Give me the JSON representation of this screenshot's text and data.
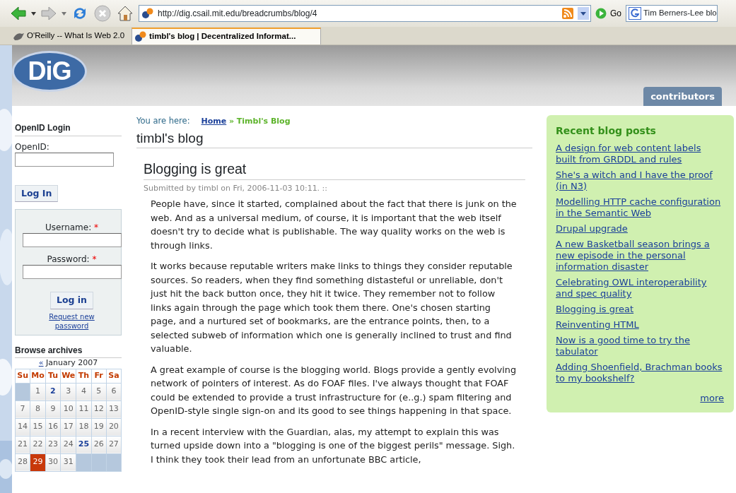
{
  "browser": {
    "url": "http://dig.csail.mit.edu/breadcrumbs/blog/4",
    "go_label": "Go",
    "search_value": "Tim Berners-Lee blo",
    "tabs": [
      {
        "label": "O'Reilly -- What Is Web 2.0",
        "selected": false
      },
      {
        "label": "timbl's blog | Decentralized Informat...",
        "selected": true
      }
    ]
  },
  "header": {
    "logo_text": "DiG",
    "nav_tab": "contributors"
  },
  "sidebar": {
    "openid": {
      "title": "OpenID Login",
      "label": "OpenID:",
      "button": "Log In"
    },
    "login": {
      "fields": [
        {
          "label": "Username:",
          "required_mark": "*"
        },
        {
          "label": "Password:",
          "required_mark": "*"
        }
      ],
      "button": "Log in",
      "link": "Request new password"
    },
    "archives": {
      "title": "Browse archives",
      "prev": "«",
      "month": "January 2007",
      "weekdays": [
        "Su",
        "Mo",
        "Tu",
        "We",
        "Th",
        "Fr",
        "Sa"
      ],
      "weeks": [
        [
          {
            "kind": "empty"
          },
          {
            "text": "1",
            "kind": "plain"
          },
          {
            "text": "2",
            "kind": "link"
          },
          {
            "text": "3",
            "kind": "plain"
          },
          {
            "text": "4",
            "kind": "plain"
          },
          {
            "text": "5",
            "kind": "plain"
          },
          {
            "text": "6",
            "kind": "plain"
          }
        ],
        [
          {
            "text": "7",
            "kind": "plain"
          },
          {
            "text": "8",
            "kind": "plain"
          },
          {
            "text": "9",
            "kind": "plain"
          },
          {
            "text": "10",
            "kind": "plain"
          },
          {
            "text": "11",
            "kind": "plain"
          },
          {
            "text": "12",
            "kind": "plain"
          },
          {
            "text": "13",
            "kind": "plain"
          }
        ],
        [
          {
            "text": "14",
            "kind": "plain"
          },
          {
            "text": "15",
            "kind": "plain"
          },
          {
            "text": "16",
            "kind": "plain"
          },
          {
            "text": "17",
            "kind": "plain"
          },
          {
            "text": "18",
            "kind": "plain"
          },
          {
            "text": "19",
            "kind": "plain"
          },
          {
            "text": "20",
            "kind": "plain"
          }
        ],
        [
          {
            "text": "21",
            "kind": "plain"
          },
          {
            "text": "22",
            "kind": "plain"
          },
          {
            "text": "23",
            "kind": "plain"
          },
          {
            "text": "24",
            "kind": "plain"
          },
          {
            "text": "25",
            "kind": "link"
          },
          {
            "text": "26",
            "kind": "plain"
          },
          {
            "text": "27",
            "kind": "plain"
          }
        ],
        [
          {
            "text": "28",
            "kind": "plain"
          },
          {
            "text": "29",
            "kind": "today"
          },
          {
            "text": "30",
            "kind": "plain"
          },
          {
            "text": "31",
            "kind": "plain"
          },
          {
            "kind": "empty"
          },
          {
            "kind": "empty"
          },
          {
            "kind": "empty"
          }
        ]
      ]
    }
  },
  "main": {
    "breadcrumb": {
      "prefix": "You are here:",
      "home": "Home",
      "separator": "»",
      "current": "Timbl's Blog"
    },
    "page_title": "timbl's blog",
    "post": {
      "title": "Blogging is great",
      "meta_prefix": "Submitted by",
      "author": "timbl",
      "meta_suffix": "on Fri, 2006-11-03 10:11. ::",
      "paragraphs": [
        "People have, since it started, complained about the fact that there is junk on the web. And as a universal medium, of course, it is important that the web itself doesn't try to decide what is publishable. The way quality works on the web is through links.",
        "It works because reputable writers make links to things they consider reputable sources. So readers, when they find something distasteful or unreliable, don't just hit the back button once, they hit it twice. They remember not to follow links again through the page which took them there. One's chosen starting page, and a nurtured set of bookmarks, are the entrance points, then, to a selected subweb of information which one is generally inclined to trust and find valuable.",
        "A great example of course is the blogging world. Blogs provide a gently evolving network of pointers of interest. As do FOAF files. I've always thought that FOAF could be extended to provide a trust infrastructure for (e..g.) spam filtering and OpenID-style single sign-on and its good to see things happening in that space.",
        "In a recent interview with the Guardian, alas, my attempt to explain this was turned upside down into a \"blogging is one of the biggest perils\" message. Sigh. I think they took their lead from an unfortunate BBC article,"
      ]
    }
  },
  "recent": {
    "title": "Recent blog posts",
    "items": [
      "A design for web content labels built from GRDDL and rules",
      "She's a witch and I have the proof (in N3)",
      "Modelling HTTP cache configuration in the Semantic Web",
      "Drupal upgrade",
      "A new Basketball season brings a new episode in the personal information disaster",
      "Celebrating OWL interoperability and spec quality",
      "Blogging is great",
      "Reinventing HTML",
      "Now is a good time to try the tabulator",
      "Adding Shoenfield, Brachman books to my bookshelf?"
    ],
    "more": "more"
  }
}
